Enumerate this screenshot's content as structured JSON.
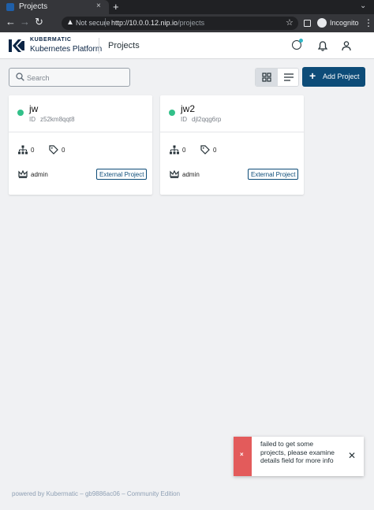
{
  "browser": {
    "tab_title": "Projects",
    "tab_close": "×",
    "new_tab": "+",
    "not_secure": "Not secure",
    "url_host": "http://10.0.0.12.nip.io",
    "url_path": "/projects",
    "incognito": "Incognito"
  },
  "header": {
    "brand_top": "KUBERMATIC",
    "brand_bottom": "Kubernetes Platform",
    "title": "Projects"
  },
  "toolbar": {
    "search_placeholder": "Search",
    "add_project_label": "Add Project",
    "add_icon": "+"
  },
  "projects": [
    {
      "name": "jw",
      "id_label": "ID",
      "id": "z52km8qqt8",
      "status": "active",
      "clusters": "0",
      "tags": "0",
      "owner": "admin",
      "badge": "External Project"
    },
    {
      "name": "jw2",
      "id_label": "ID",
      "id": "djl2qqg6rp",
      "status": "active",
      "clusters": "0",
      "tags": "0",
      "owner": "admin",
      "badge": "External Project"
    }
  ],
  "notification": {
    "icon": "×",
    "message": "failed to get some projects, please examine details field for more info",
    "close": "✕"
  },
  "footer": {
    "text": "powered by Kubermatic  –  gb9886ac06  –  Community Edition"
  },
  "colors": {
    "primary": "#0d4c78",
    "status_active": "#32c089",
    "error": "#e35b5b"
  }
}
